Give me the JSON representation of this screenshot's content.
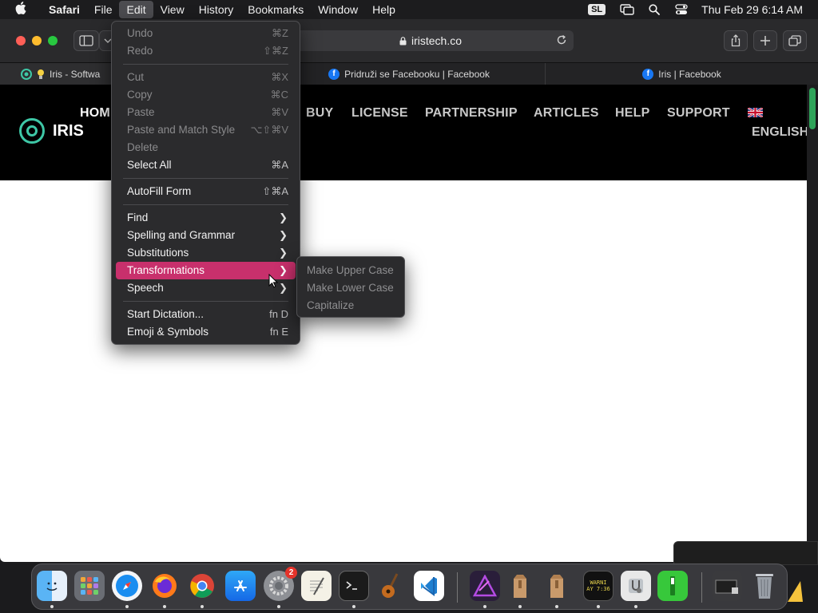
{
  "menubar": {
    "app_name": "Safari",
    "items": [
      "File",
      "Edit",
      "View",
      "History",
      "Bookmarks",
      "Window",
      "Help"
    ],
    "input_badge": "SL",
    "clock": "Thu Feb 29  6:14 AM"
  },
  "browser": {
    "url": "iristech.co",
    "tabs": [
      {
        "title": "Iris - Softwa"
      },
      {
        "title": "Pridruži se Facebooku | Facebook"
      },
      {
        "title": "Iris | Facebook"
      }
    ]
  },
  "site": {
    "brand": "IRIS",
    "nav": {
      "home": "HOM",
      "buy": "BUY",
      "license": "LICENSE",
      "partnership": "PARTNERSHIP",
      "articles": "ARTICLES",
      "help": "HELP",
      "support": "SUPPORT",
      "language": "ENGLISH"
    }
  },
  "edit_menu": {
    "undo": {
      "label": "Undo",
      "shortcut": "⌘Z"
    },
    "redo": {
      "label": "Redo",
      "shortcut": "⇧⌘Z"
    },
    "cut": {
      "label": "Cut",
      "shortcut": "⌘X"
    },
    "copy": {
      "label": "Copy",
      "shortcut": "⌘C"
    },
    "paste": {
      "label": "Paste",
      "shortcut": "⌘V"
    },
    "paste_match": {
      "label": "Paste and Match Style",
      "shortcut": "⌥⇧⌘V"
    },
    "delete": {
      "label": "Delete"
    },
    "select_all": {
      "label": "Select All",
      "shortcut": "⌘A"
    },
    "autofill": {
      "label": "AutoFill Form",
      "shortcut": "⇧⌘A"
    },
    "find": {
      "label": "Find"
    },
    "spelling": {
      "label": "Spelling and Grammar"
    },
    "substitutions": {
      "label": "Substitutions"
    },
    "transformations": {
      "label": "Transformations"
    },
    "speech": {
      "label": "Speech"
    },
    "dictation": {
      "label": "Start Dictation...",
      "shortcut": "fn D"
    },
    "emoji": {
      "label": "Emoji & Symbols",
      "shortcut": "fn E"
    }
  },
  "transformations_submenu": {
    "upper": "Make Upper Case",
    "lower": "Make Lower Case",
    "capitalize": "Capitalize"
  },
  "dock": {
    "settings_badge": "2",
    "console_text": "WARNI\nAY 7:36"
  },
  "colors": {
    "menu_highlight": "#c8306c",
    "iris_accent": "#3ec7a6",
    "facebook_blue": "#1877f2"
  }
}
